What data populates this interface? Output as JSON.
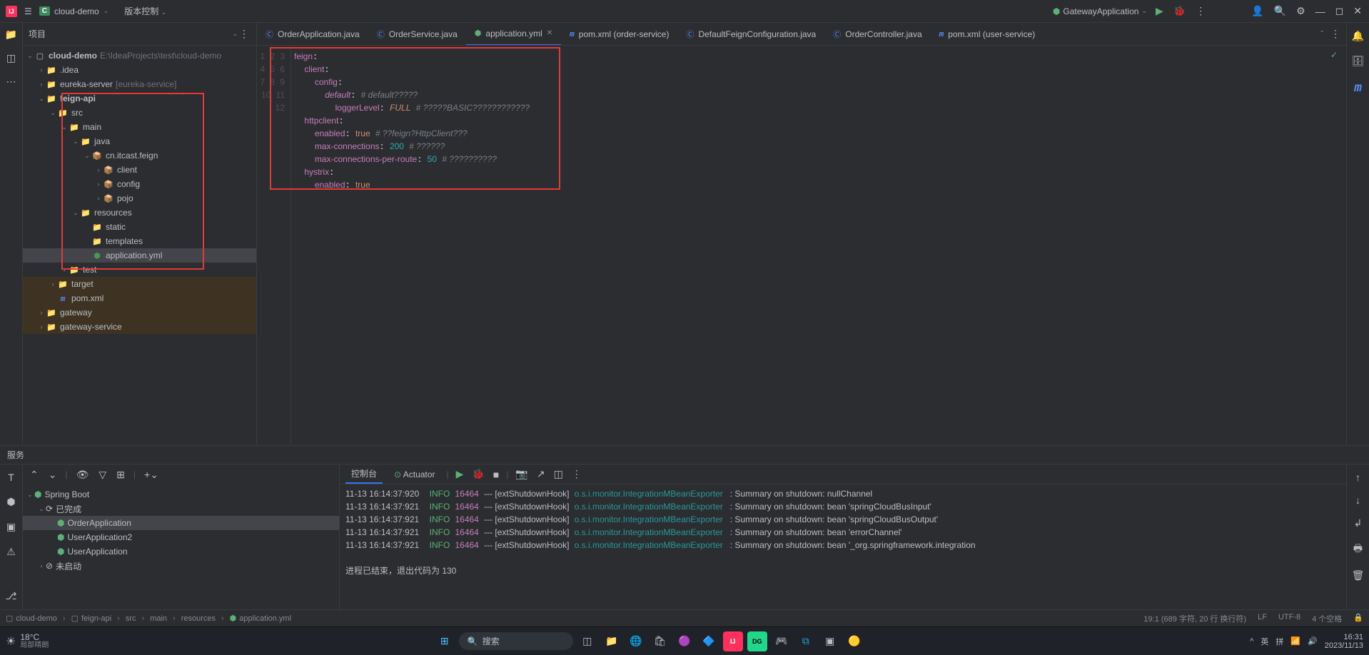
{
  "title": {
    "project_badge": "C",
    "project_name": "cloud-demo",
    "vcs_label": "版本控制",
    "run_config": "GatewayApplication"
  },
  "project_panel": {
    "title": "项目"
  },
  "tree": {
    "root": "cloud-demo",
    "root_path": "E:\\IdeaProjects\\test\\cloud-demo",
    "idea": ".idea",
    "eureka": "eureka-server",
    "eureka_svc": "[eureka-service]",
    "feign_api": "feign-api",
    "src": "src",
    "main": "main",
    "java": "java",
    "pkg": "cn.itcast.feign",
    "client": "client",
    "config": "config",
    "pojo": "pojo",
    "resources": "resources",
    "static": "static",
    "templates": "templates",
    "appyml": "application.yml",
    "test": "test",
    "target": "target",
    "pom": "pom.xml",
    "gateway": "gateway",
    "gateway_svc": "gateway-service"
  },
  "tabs": {
    "t0": "OrderApplication.java",
    "t1": "OrderService.java",
    "t2": "application.yml",
    "t3": "pom.xml (order-service)",
    "t4": "DefaultFeignConfiguration.java",
    "t5": "OrderController.java",
    "t6": "pom.xml (user-service)"
  },
  "gutter": {
    "l1": "1",
    "l2": "2",
    "l3": "3",
    "l4": "4",
    "l5": "5",
    "l6": "6",
    "l7": "7",
    "l8": "8",
    "l9": "9",
    "l10": "10",
    "l11": "11",
    "l12": "12"
  },
  "code": {
    "k_feign": "feign",
    "k_client": "client",
    "k_config": "config",
    "k_default": "default",
    "c_default": "# default?????",
    "k_loggerLevel": "loggerLevel",
    "v_full": "FULL",
    "c_full": "# ?????BASIC????????????",
    "k_httpclient": "httpclient",
    "k_enabled": "enabled",
    "v_true": "true",
    "c_feign": "# ??feign?HttpClient???",
    "k_maxconn": "max-connections",
    "v_200": "200",
    "c_200": "# ??????",
    "k_maxroute": "max-connections-per-route",
    "v_50": "50",
    "c_50": "# ??????????",
    "k_hystrix": "hystrix"
  },
  "services": {
    "header": "服务",
    "spring_boot": "Spring Boot",
    "done": "已完成",
    "app0": "OrderApplication",
    "app1": "UserApplication2",
    "app2": "UserApplication",
    "not_started": "未启动",
    "tab_console": "控制台",
    "tab_actuator": "Actuator"
  },
  "log": {
    "l0_t": "11-13 16:14:37:920",
    "l0_i": "INFO",
    "l0_p": "16464",
    "l0_s": "--- [extShutdownHook]",
    "l0_c": "o.s.i.monitor.IntegrationMBeanExporter",
    "l0_m": "   : Summary on shutdown: nullChannel",
    "l1_t": "11-13 16:14:37:921",
    "l1_i": "INFO",
    "l1_p": "16464",
    "l1_s": "--- [extShutdownHook]",
    "l1_c": "o.s.i.monitor.IntegrationMBeanExporter",
    "l1_m": "   : Summary on shutdown: bean 'springCloudBusInput'",
    "l2_t": "11-13 16:14:37:921",
    "l2_i": "INFO",
    "l2_p": "16464",
    "l2_s": "--- [extShutdownHook]",
    "l2_c": "o.s.i.monitor.IntegrationMBeanExporter",
    "l2_m": "   : Summary on shutdown: bean 'springCloudBusOutput'",
    "l3_t": "11-13 16:14:37:921",
    "l3_i": "INFO",
    "l3_p": "16464",
    "l3_s": "--- [extShutdownHook]",
    "l3_c": "o.s.i.monitor.IntegrationMBeanExporter",
    "l3_m": "   : Summary on shutdown: bean 'errorChannel'",
    "l4_t": "11-13 16:14:37:921",
    "l4_i": "INFO",
    "l4_p": "16464",
    "l4_s": "--- [extShutdownHook]",
    "l4_c": "o.s.i.monitor.IntegrationMBeanExporter",
    "l4_m": "   : Summary on shutdown: bean '_org.springframework.integration",
    "exit": "进程已结束，退出代码为 130"
  },
  "breadcrumb": {
    "b0": "cloud-demo",
    "b1": "feign-api",
    "b2": "src",
    "b3": "main",
    "b4": "resources",
    "b5": "application.yml"
  },
  "status": {
    "pos": "19:1 (689 字符, 20 行 换行符)",
    "enc_lf": "LF",
    "enc_utf": "UTF-8",
    "indent": "4 个空格"
  },
  "taskbar": {
    "weather_temp": "18°C",
    "weather_cond": "局部晴朗",
    "search": "搜索",
    "ime_1": "英",
    "ime_2": "拼",
    "time": "16:31",
    "date": "2023/11/13"
  }
}
